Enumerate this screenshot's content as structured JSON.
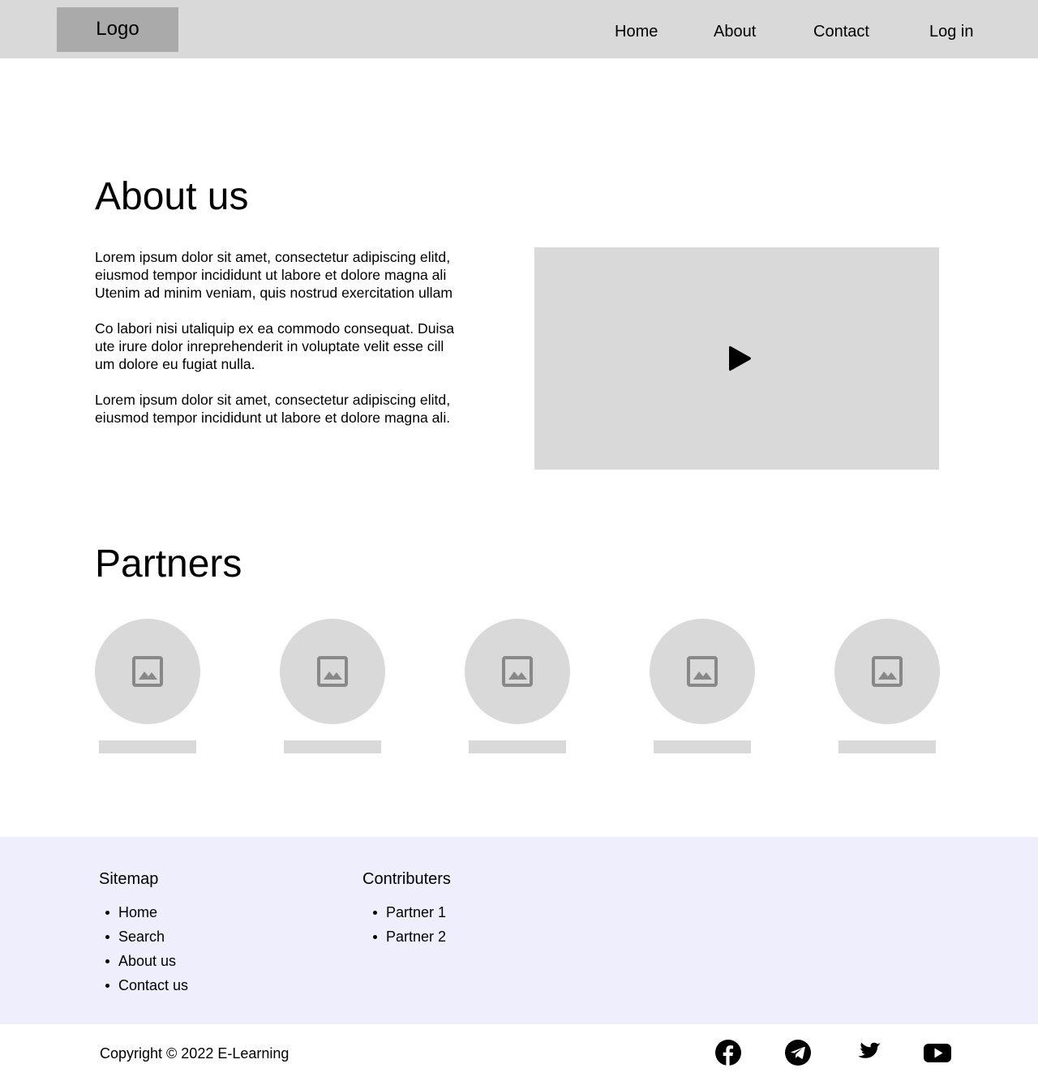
{
  "header": {
    "logo": "Logo",
    "nav": [
      {
        "label": "Home"
      },
      {
        "label": "About"
      },
      {
        "label": "Contact"
      },
      {
        "label": "Log in"
      }
    ]
  },
  "about": {
    "title": "About us",
    "paragraphs": [
      [
        "Lorem ipsum dolor sit amet, consectetur adipiscing elitd,",
        "eiusmod tempor incididunt ut labore et dolore magna ali",
        "Utenim ad minim veniam, quis nostrud exercitation ullam"
      ],
      [
        "Co labori nisi utaliquip ex ea commodo consequat. Duisa",
        "ute irure dolor inreprehenderit in voluptate velit esse cill",
        "um dolore eu fugiat nulla."
      ],
      [
        "Lorem ipsum dolor sit amet, consectetur adipiscing elitd,",
        "eiusmod tempor incididunt ut labore et dolore magna ali."
      ]
    ],
    "video_icon": "play-icon"
  },
  "partners": {
    "title": "Partners",
    "items": [
      {
        "icon": "image-placeholder-icon"
      },
      {
        "icon": "image-placeholder-icon"
      },
      {
        "icon": "image-placeholder-icon"
      },
      {
        "icon": "image-placeholder-icon"
      },
      {
        "icon": "image-placeholder-icon"
      }
    ]
  },
  "footer": {
    "sitemap": {
      "heading": "Sitemap",
      "links": [
        "Home",
        "Search",
        "About us",
        "Contact us"
      ]
    },
    "contributers": {
      "heading": "Contributers",
      "links": [
        "Partner 1",
        "Partner 2"
      ]
    },
    "copyright": "Copyright © 2022 E-Learning",
    "social": [
      "facebook-icon",
      "telegram-icon",
      "twitter-icon",
      "youtube-icon"
    ]
  },
  "colors": {
    "header_bg": "#d9d9d9",
    "logo_bg": "#aaaaaa",
    "placeholder": "#d9d9d9",
    "footer_bg": "#eeeefc",
    "icon_gray": "#888888"
  }
}
